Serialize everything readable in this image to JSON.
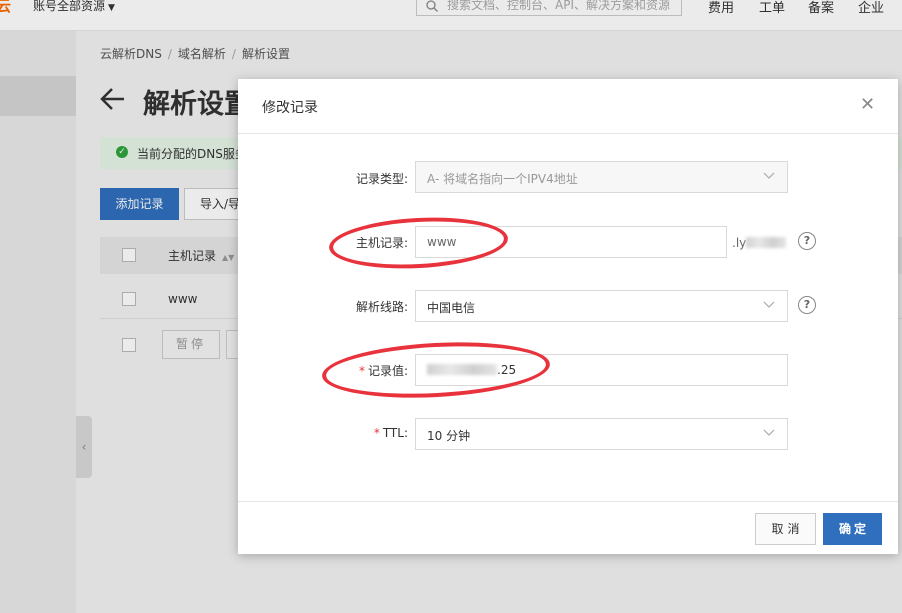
{
  "topbar": {
    "brand": "云",
    "scope": "账号全部资源",
    "search_placeholder": "搜索文档、控制台、API、解决方案和资源",
    "nav": [
      "费用",
      "工单",
      "备案",
      "企业"
    ]
  },
  "breadcrumb": [
    "云解析DNS",
    "域名解析",
    "解析设置"
  ],
  "page": {
    "title": "解析设置",
    "notice": "当前分配的DNS服务",
    "add_record": "添加记录",
    "import": "导入/导出"
  },
  "table": {
    "header_host": "主机记录",
    "row_host": "www",
    "pause": "暂停"
  },
  "modal": {
    "title": "修改记录",
    "record_type_label": "记录类型:",
    "record_type_value": "A- 将域名指向一个IPV4地址",
    "host_label": "主机记录:",
    "host_value": "www",
    "domain_suffix_start": ".ly",
    "line_label": "解析线路:",
    "line_value": "中国电信",
    "value_label": "记录值:",
    "value_tail": ".25",
    "ttl_label": "TTL:",
    "ttl_value": "10 分钟",
    "cancel": "取消",
    "confirm": "确定"
  },
  "colors": {
    "primary": "#2f6fbd",
    "annotation": "#e8323c",
    "brand": "#ff6a00",
    "success": "#2fa33c"
  },
  "icons": [
    "search-icon",
    "back-arrow-icon",
    "success-icon",
    "close-icon",
    "chevron-down-icon",
    "help-icon",
    "sort-icon",
    "collapse-icon"
  ]
}
